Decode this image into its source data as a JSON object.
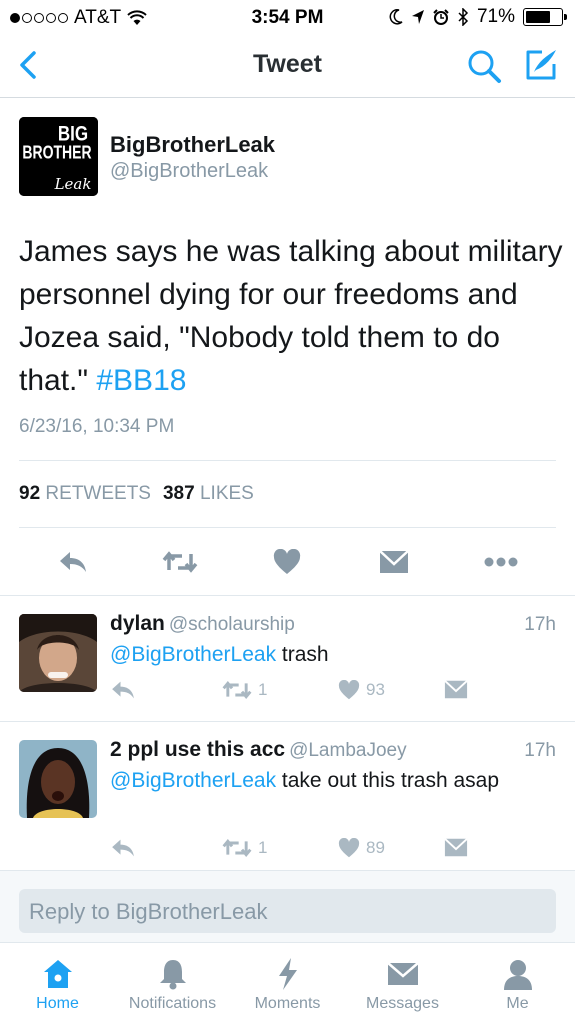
{
  "status_bar": {
    "carrier": "AT&T",
    "time": "3:54 PM",
    "battery": "71%",
    "battery_level": 0.71
  },
  "nav": {
    "title": "Tweet"
  },
  "tweet": {
    "logo_text": [
      "BIG",
      "BROTHER",
      "Leak"
    ],
    "author_name": "BigBrotherLeak",
    "author_handle": "@BigBrotherLeak",
    "text": "James says he was talking about military personnel dying for our freedoms and Jozea said, \"Nobody told them to do that.\" ",
    "hashtag": "#BB18",
    "timestamp": "6/23/16, 10:34 PM",
    "retweets_count": "92",
    "retweets_label": "RETWEETS",
    "likes_count": "387",
    "likes_label": "LIKES"
  },
  "replies": [
    {
      "name": "dylan",
      "handle": "@scholaurship",
      "time": "17h",
      "mention": "@BigBrotherLeak",
      "text": " trash",
      "retweets": "1",
      "likes": "93"
    },
    {
      "name": "2 ppl use this acc",
      "handle": "@LambaJoey",
      "time": "17h",
      "mention": "@BigBrotherLeak",
      "text": " take out this trash asap",
      "retweets": "1",
      "likes": "89"
    }
  ],
  "reply_box": {
    "placeholder": "Reply to BigBrotherLeak"
  },
  "tabs": [
    {
      "label": "Home",
      "icon": "home-icon",
      "active": true
    },
    {
      "label": "Notifications",
      "icon": "bell-icon",
      "active": false
    },
    {
      "label": "Moments",
      "icon": "lightning-icon",
      "active": false
    },
    {
      "label": "Messages",
      "icon": "envelope-icon",
      "active": false
    },
    {
      "label": "Me",
      "icon": "person-icon",
      "active": false
    }
  ],
  "colors": {
    "accent": "#1da1f2",
    "muted": "#8899a6",
    "icon_gray": "#aab8c2",
    "text": "#14171a"
  }
}
